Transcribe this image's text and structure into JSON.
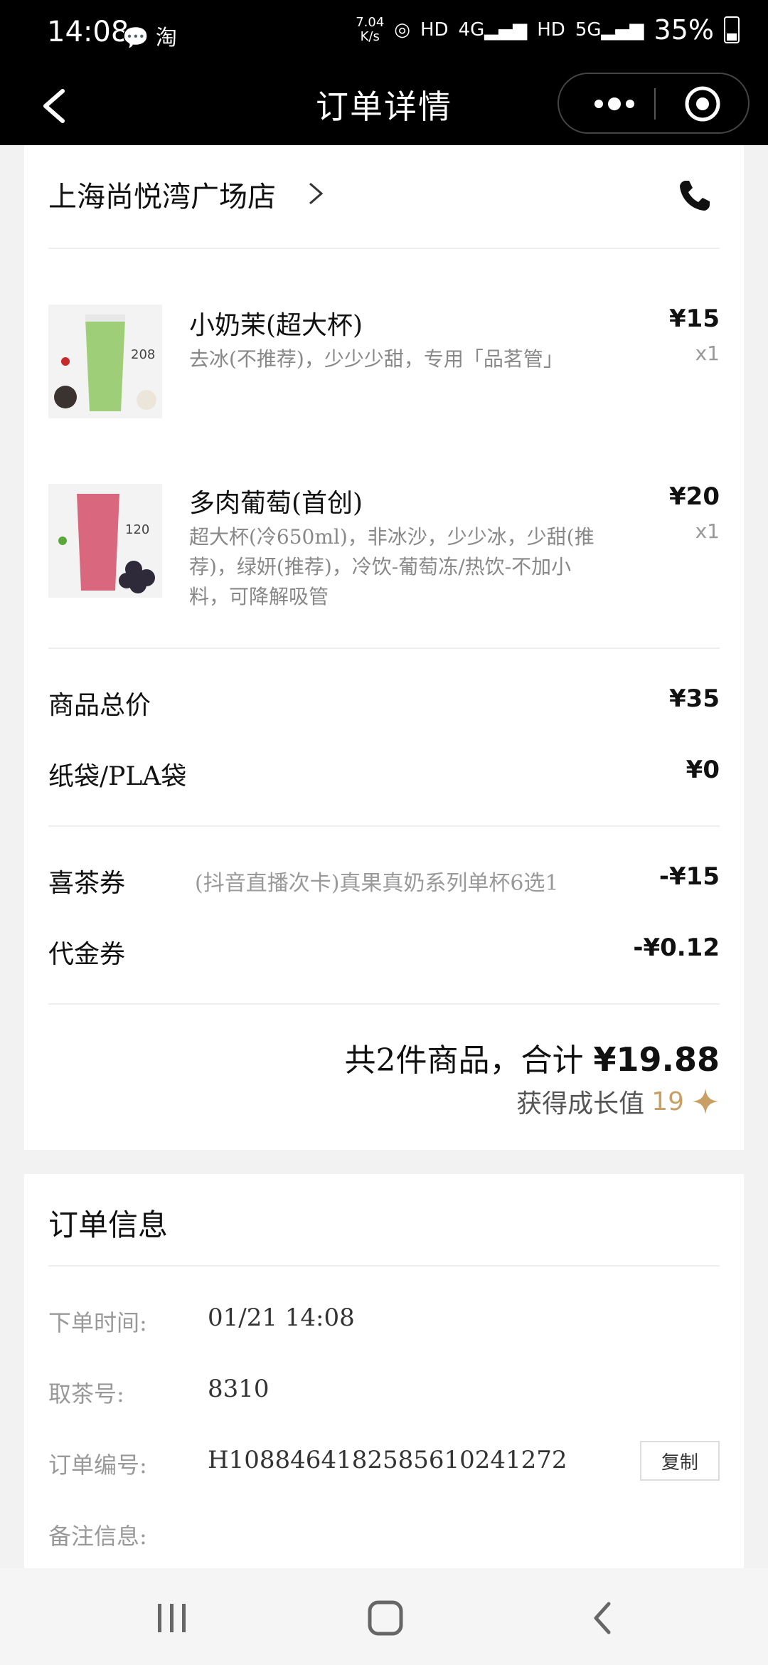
{
  "status_bar": {
    "time": "14:08",
    "left_icons": "wechat-icon taobao-icon",
    "speed_value": "7.04",
    "speed_unit": "K/s",
    "hd1": "HD",
    "net1": "4G",
    "hd2": "HD",
    "net2": "5G",
    "battery": "35%"
  },
  "nav": {
    "title": "订单详情"
  },
  "store": {
    "name": "上海尚悦湾广场店"
  },
  "items": [
    {
      "name": "小奶茉(超大杯)",
      "spec": "去冰(不推荐)，少少少甜，专用「品茗管」",
      "price": "¥15",
      "qty": "x1",
      "thumb_badge": "208",
      "thumb_color": "#9fce78"
    },
    {
      "name": "多肉葡萄(首创)",
      "spec": "超大杯(冷650ml)，非冰沙，少少冰，少甜(推荐)，绿妍(推荐)，冷饮-葡萄冻/热饮-不加小料，可降解吸管",
      "price": "¥20",
      "qty": "x1",
      "thumb_badge": "120",
      "thumb_color": "#d9677e"
    }
  ],
  "summary": {
    "goods_total_label": "商品总价",
    "goods_total_value": "¥35",
    "bag_label": "纸袋/PLA袋",
    "bag_value": "¥0",
    "coupon_label": "喜茶券",
    "coupon_desc": "(抖音直播次卡)真果真奶系列单杯6选1",
    "coupon_value": "-¥15",
    "voucher_label": "代金券",
    "voucher_value": "-¥0.12",
    "total_prefix": "共2件商品，合计",
    "total_amount": "¥19.88",
    "growth_label": "获得成长值",
    "growth_value": "19"
  },
  "order_info": {
    "title": "订单信息",
    "time_label": "下单时间:",
    "time_value": "01/21 14:08",
    "pickup_label": "取茶号:",
    "pickup_value": "8310",
    "order_no_label": "订单编号:",
    "order_no_value": "H108846418258561024127​2",
    "copy_label": "复制",
    "remark_label": "备注信息:"
  },
  "colors": {
    "accent_gold": "#c9a063",
    "bar_black": "#000000"
  }
}
